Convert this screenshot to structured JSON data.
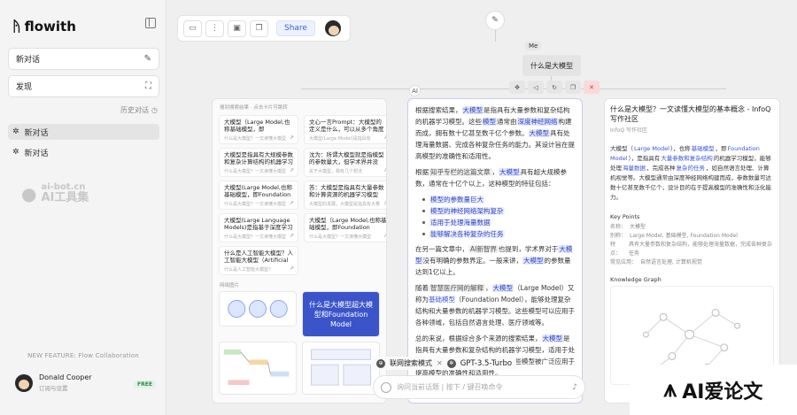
{
  "app": {
    "name": "flowith"
  },
  "sidebar": {
    "new_chat": "新对话",
    "discover": "发现",
    "history_label": "历史对话",
    "chats": [
      "新对话",
      "新对话"
    ],
    "watermark": {
      "domain": "ai-bot.cn",
      "name": "AI工具集"
    },
    "feature_banner": "NEW FEATURE: Flow Collaboration",
    "user": {
      "name": "Donald Cooper",
      "subtitle": "订阅与设置",
      "plan": "FREE"
    }
  },
  "toolbar": {
    "share_label": "Share"
  },
  "nodes": {
    "me_label": "Me",
    "question": "什么是大模型",
    "ai_label": "AI"
  },
  "search_panel": {
    "header": "搜到搜索结果 · 点击卡片可跳转",
    "sources": [
      {
        "title": "大模型（Large Model,也称基础模型，即Foundation",
        "desc": "什么是大模型？一文读懂大模型"
      },
      {
        "title": "文心一言Prompt：大模型的定义是什么，可以从多个角度",
        "desc": "大模型(Large Model)是指具有"
      },
      {
        "title": "大模型是指具有大规模参数和复杂计算结构的机器学习模",
        "desc": "什么是大模型？一文读懂大模型"
      },
      {
        "title": "沈为：所谓大模型就是指模型的参数量大，但学术界并没",
        "desc": "关于大模型，我有几个想法"
      },
      {
        "title": "大模型(Large Model,也称基础模型，即Foundation",
        "desc": "什么是大模型？一文读懂大模型"
      },
      {
        "title": "答：大模型是指具有大量参数和计算资源的机器学习模型",
        "desc": "大模型的发展，大模型是指具有大量"
      },
      {
        "title": "大模型(Large Language Models)是指基于深度学习",
        "desc": "什么是大模型？一文读懂大模型"
      },
      {
        "title": "大模型（Large Model,也称基础模型，即Foundation",
        "desc": "什么是大模型？一文读懂大模型"
      },
      {
        "title": "什么是人工智能大模型？人工智能大模型（Artificial",
        "desc": "什么是人工智能大模型？"
      }
    ],
    "images_label": "网络图片",
    "image_caption": "什么是大模型超大模型和Foundation Model"
  },
  "answer": {
    "p1_pre": "根据搜索结果，",
    "p1_hl1": "大模型",
    "p1_mid1": "是指具有大量参数和复杂结构的机器学习模型。这些",
    "p1_hl2": "模型",
    "p1_mid2": "通常由",
    "p1_hl3": "深度神经网络",
    "p1_mid3": "构建而成，拥有数十亿甚至数千亿个参数。",
    "p1_hl4": "大模型",
    "p1_end": "具有处理海量数据、完成各种复杂任务的能力。其设计旨在提高模型的准确性和适用性。",
    "p2_pre": "根据",
    "p2_tag": "知乎专栏的这篇文章",
    "p2_mid": "，",
    "p2_hl": "大模型",
    "p2_end": "具有超大规模参数，通常在十亿个以上，这种模型的特征包括：",
    "bullets": [
      "模型的参数量巨大",
      "模型的神经网络架构复杂",
      "适用于处理海量数据",
      "能够解决各种复杂的任务"
    ],
    "p3_pre": "在另一篇文章中，",
    "p3_tag": "AI新智界",
    "p3_mid": "也提到，学术界对于",
    "p3_hl1": "大模型",
    "p3_mid2": "没有明确的参数界定。一般来讲，",
    "p3_hl2": "大模型",
    "p3_end": "的参数量达到1亿以上。",
    "p4_pre": "随着",
    "p4_tag": "智慧医疗网的解释",
    "p4_mid": "，",
    "p4_hl1": "大模型",
    "p4_mid2": "（Large Model）又称为",
    "p4_lnk": "基础模型",
    "p4_mid3": "（Foundation Model），能够处理复杂结构和大量参数的机器学习模型。这些模型可以应用于各种领域，包括自然语言处理、医疗领域等。",
    "p5_pre": "总的来说，根据综合多个来源的搜索结果，",
    "p5_hl": "大模型",
    "p5_end": "是指具有大量参数和复杂结构的机器学习模型，适用于处理大规模数据和解决复杂任务。这些模型被广泛应用于提高模型的准确性和适用性。"
  },
  "detail": {
    "title": "什么是大模型？一文读懂大模型的基本概念 - InfoQ 写作社区",
    "subtitle": "InfoQ 写作社区",
    "body_pre": "大模型（",
    "body_hl1": "Large Model",
    "body_mid1": "），也称",
    "body_hl2": "基础模型",
    "body_mid2": "，即",
    "body_hl3": "Foundation Model",
    "body_mid3": "），是指具有",
    "body_hl4": "大量参数和复杂结构",
    "body_mid4": "的机器学习模型，能够处理",
    "body_hl5": "海量数据",
    "body_mid5": "，完成各种",
    "body_hl6": "复杂的任务",
    "body_end": "，如自然语言处理、计算机视觉等。大模型通常由深度神经网络构建而成，参数数量可达数十亿甚至数千亿个，设计目的在于提高模型的准确性和泛化能力。",
    "kp_title": "Key Points",
    "kp_rows": [
      {
        "k": "名称：",
        "v": "大模型"
      },
      {
        "k": "别称：",
        "v": "Large Model, 基础模型, Foundation Model"
      },
      {
        "k": "特点：",
        "v": "具有大量参数和复杂结构，能够处理海量数据，完成各种复杂任务"
      },
      {
        "k": "常见应用：",
        "v": "自然语言处理, 计算机视觉"
      }
    ],
    "kg_title": "Knowledge Graph"
  },
  "input": {
    "mode": "联网搜索模式",
    "model": "GPT-3.5-Turbo",
    "placeholder": "询问当前话题 | 按下 / 键召唤命令"
  },
  "corner_badge": {
    "text": "AI爱论文"
  }
}
